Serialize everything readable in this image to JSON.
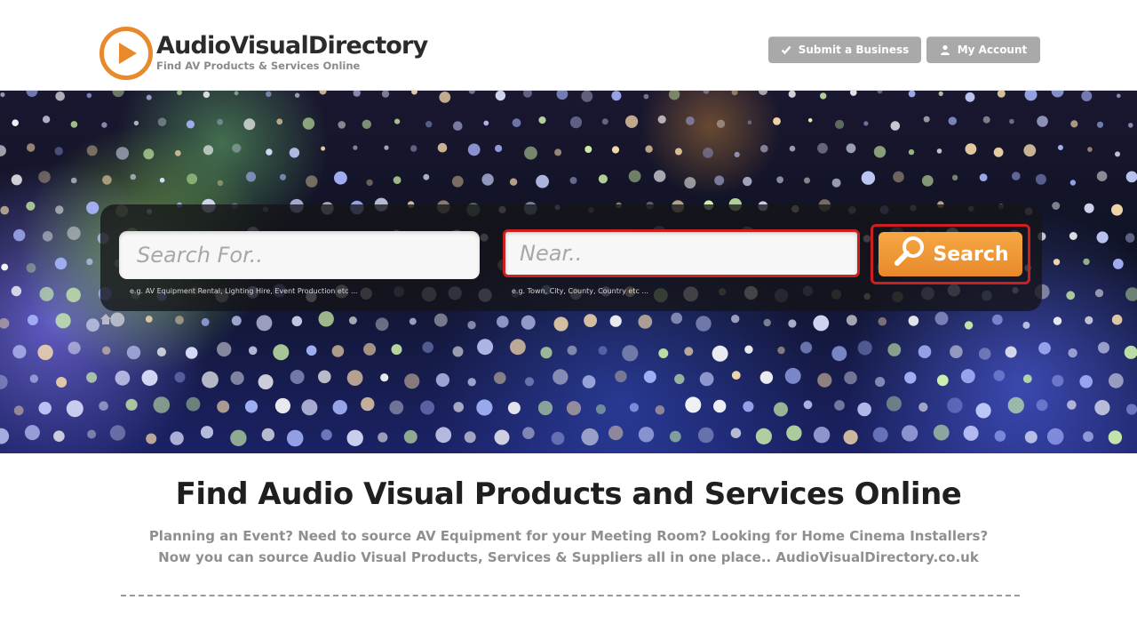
{
  "header": {
    "logo_title": "AudioVisualDirectory",
    "logo_tagline": "Find AV Products & Services Online",
    "buttons": [
      {
        "label": "Submit a Business",
        "icon": "check-icon"
      },
      {
        "label": "My Account",
        "icon": "user-icon"
      }
    ]
  },
  "search": {
    "search_for_placeholder": "Search For..",
    "search_for_hint": "e.g. AV Equipment Rental, Lighting Hire, Event Production etc ...",
    "near_placeholder": "Near..",
    "near_hint": "e.g. Town, City, County, Country etc ...",
    "button_label": "Search",
    "button_icon": "magnifier-icon"
  },
  "content": {
    "title": "Find Audio Visual Products and Services Online",
    "line1": "Planning an Event? Need to source AV Equipment for your Meeting Room? Looking for Home Cinema Installers?",
    "line2": "Now you can source Audio Visual Products, Services & Suppliers all in one place.. AudioVisualDirectory.co.uk"
  },
  "colors": {
    "brand_orange": "#e8892b",
    "header_button_gray": "#a9a9a9",
    "highlight_red": "#cc1f1f"
  }
}
